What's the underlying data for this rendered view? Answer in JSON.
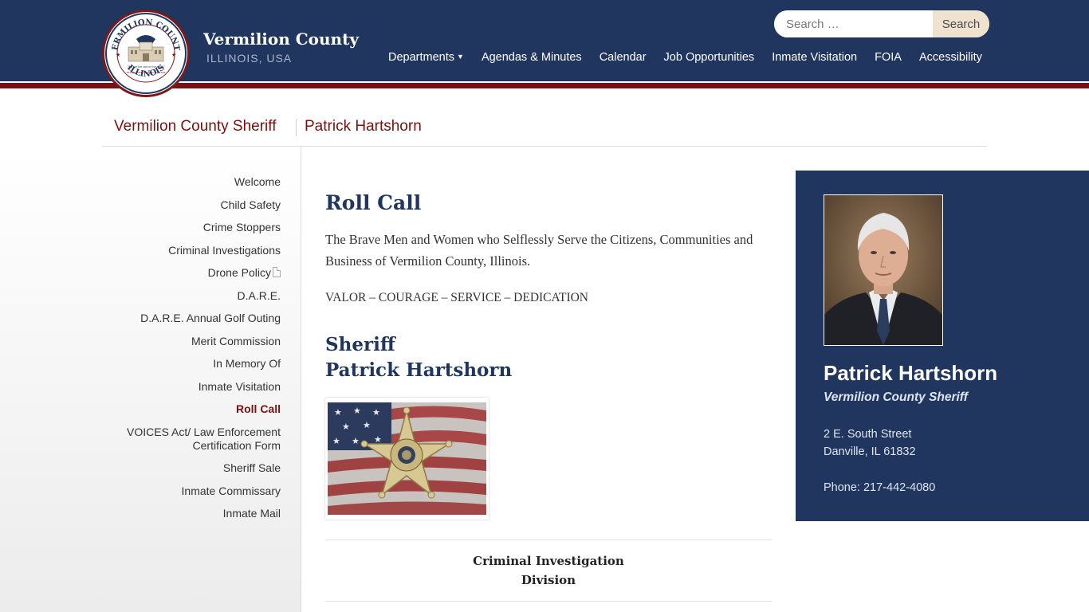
{
  "header": {
    "logo_alt": "Vermilion County Illinois seal",
    "logo_text": {
      "top": "VERMILION COUNTY",
      "bottom": "ILLINOIS",
      "motto": "\"We are the salt of the earth\"",
      "est": "ESTABLISHED JANUARY 18, 1826"
    },
    "site_title": "Vermilion County",
    "site_subtitle": "ILLINOIS, USA",
    "search": {
      "placeholder": "Search …",
      "button_label": "Search"
    },
    "nav": [
      {
        "label": "Departments",
        "has_dropdown": true
      },
      {
        "label": "Agendas & Minutes"
      },
      {
        "label": "Calendar"
      },
      {
        "label": "Job Opportunities"
      },
      {
        "label": "Inmate Visitation"
      },
      {
        "label": "FOIA"
      },
      {
        "label": "Accessibility"
      }
    ]
  },
  "breadcrumb": {
    "parent": "Vermilion County Sheriff",
    "current": "Patrick Hartshorn"
  },
  "sidebar": {
    "items": [
      {
        "label": "Welcome"
      },
      {
        "label": "Child Safety"
      },
      {
        "label": "Crime Stoppers"
      },
      {
        "label": "Criminal Investigations"
      },
      {
        "label": "Drone Policy",
        "icon": "pdf-file-icon"
      },
      {
        "label": "D.A.R.E."
      },
      {
        "label": "D.A.R.E. Annual Golf Outing"
      },
      {
        "label": "Merit Commission"
      },
      {
        "label": "In Memory Of"
      },
      {
        "label": "Inmate Visitation"
      },
      {
        "label": "Roll Call",
        "active": true
      },
      {
        "label": "VOICES Act/ Law Enforcement Certification Form"
      },
      {
        "label": "Sheriff Sale"
      },
      {
        "label": "Inmate Commissary"
      },
      {
        "label": "Inmate Mail"
      }
    ]
  },
  "main": {
    "heading": "Roll Call",
    "intro": "The Brave Men and Women who Selflessly Serve the Citizens, Communities and Business of Vermilion County, Illinois.",
    "motto": "VALOR – COURAGE – SERVICE – DEDICATION",
    "sheriff_heading_line1": "Sheriff",
    "sheriff_heading_line2": "Patrick Hartshorn",
    "badge_image_alt": "Deputy Sheriff Vermilion County star badge on American flag",
    "division_line1": "Criminal Investigation",
    "division_line2": "Division"
  },
  "card": {
    "photo_alt": "Portrait of Patrick Hartshorn",
    "name": "Patrick Hartshorn",
    "title": "Vermilion County Sheriff",
    "address_line1": "2 E. South Street",
    "address_line2": "Danville, IL 61832",
    "phone": "Phone: 217-442-4080"
  },
  "colors": {
    "header_bg": "#20365f",
    "accent_red": "#7a1010",
    "search_button_bg": "#efe3cf",
    "card_bg": "#20365f"
  }
}
